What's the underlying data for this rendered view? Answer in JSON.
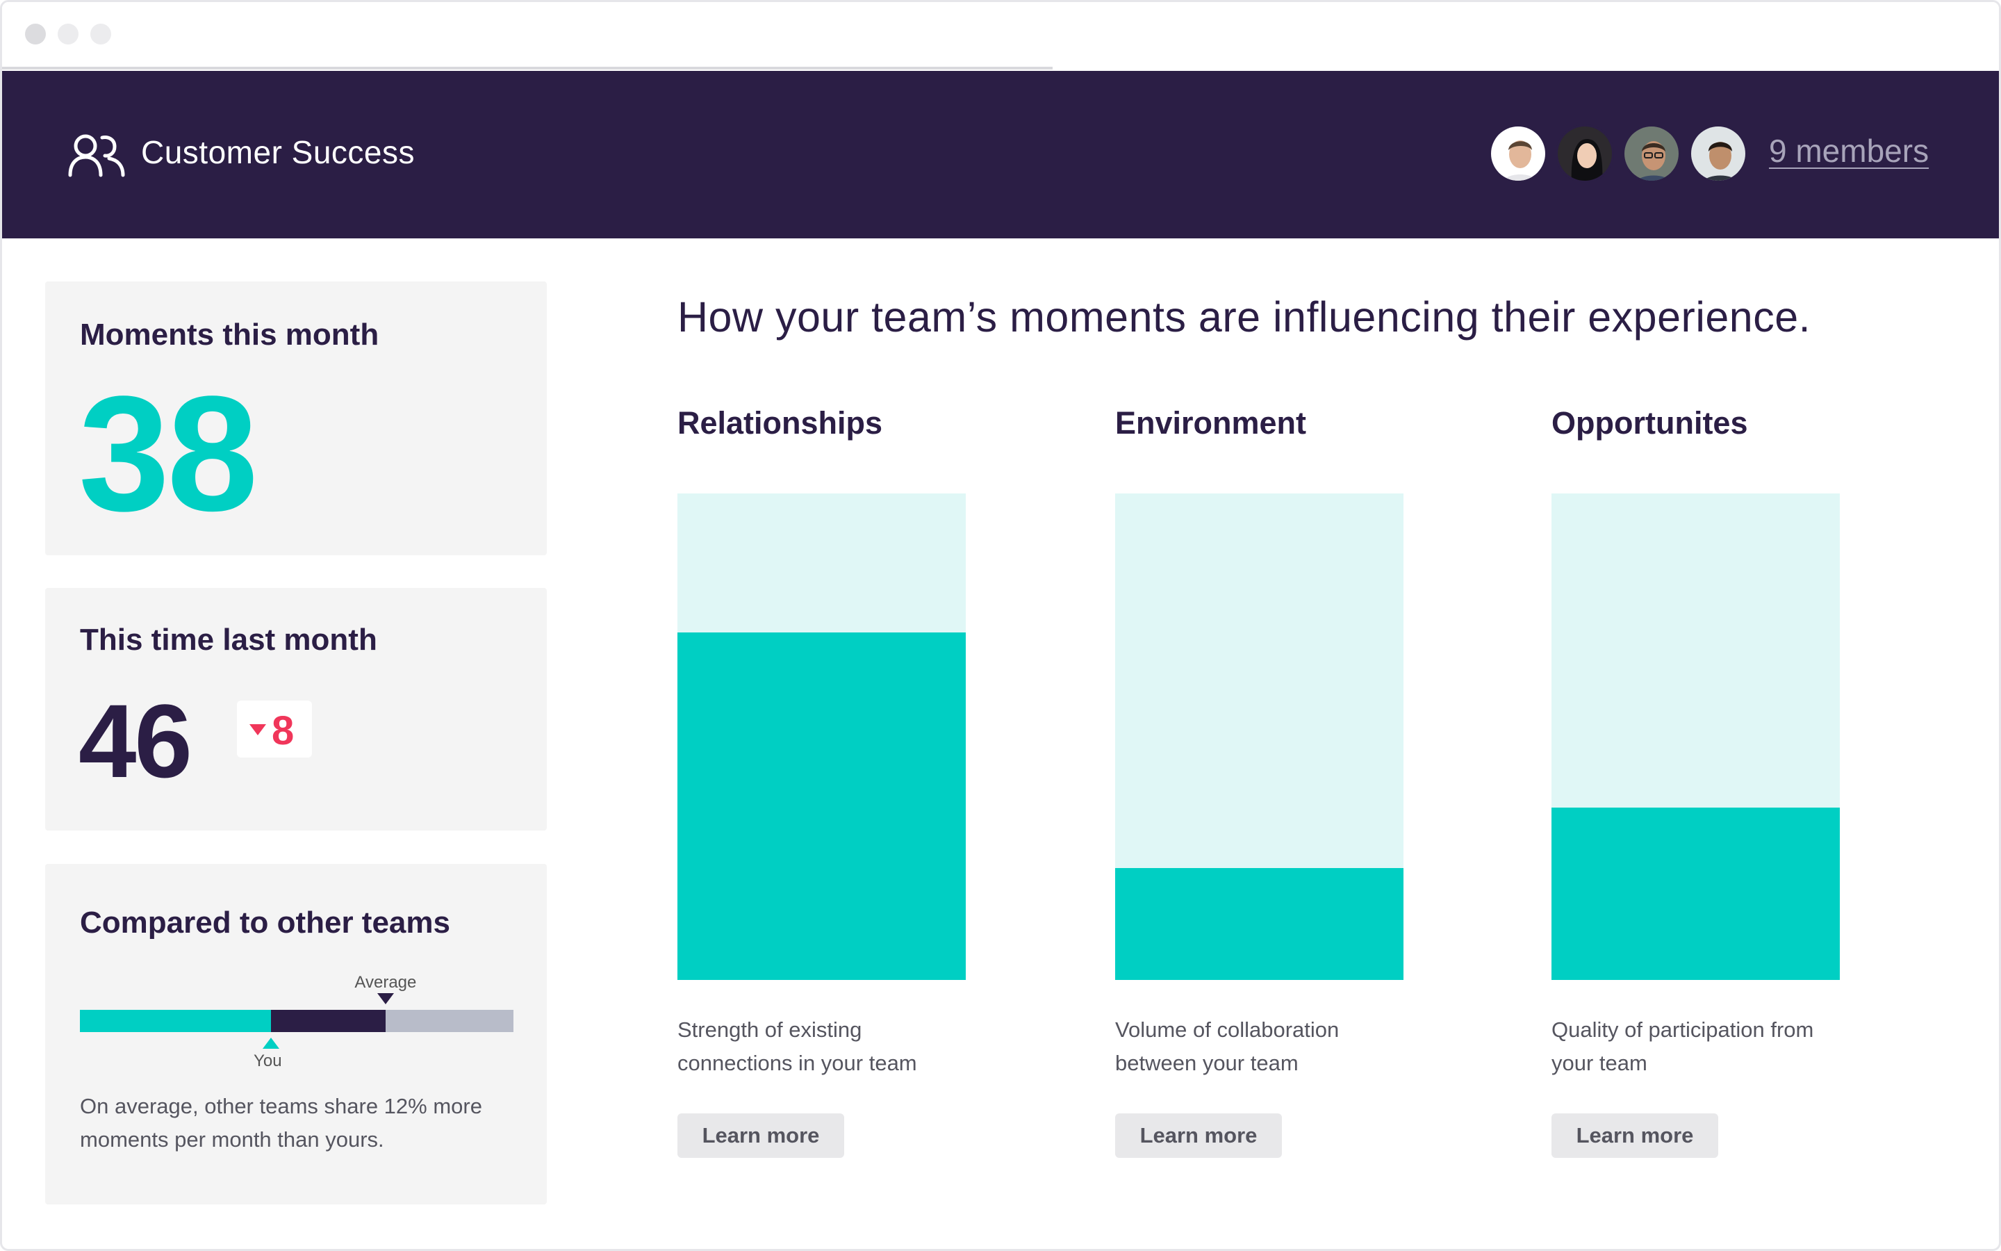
{
  "header": {
    "team_name": "Customer Success",
    "members_link": "9 members",
    "avatars": [
      {
        "name": "member-1",
        "skin": "#e2b79a",
        "hair": "#5a4534",
        "bg": "#ffffff"
      },
      {
        "name": "member-2",
        "skin": "#f0cdb5",
        "hair": "#0f0f12",
        "bg": "#2d2a2e"
      },
      {
        "name": "member-3",
        "skin": "#c69474",
        "hair": "#3a2c22",
        "bg": "#6f7a72"
      },
      {
        "name": "member-4",
        "skin": "#bf8f6c",
        "hair": "#241a14",
        "bg": "#dfe4e6"
      }
    ]
  },
  "cards": {
    "moments": {
      "title": "Moments this month",
      "value": "38"
    },
    "last_month": {
      "title": "This time last month",
      "value": "46",
      "delta": "8"
    },
    "compare": {
      "title": "Compared to other teams",
      "average_label": "Average",
      "you_label": "You",
      "you_fraction": 0.44,
      "average_fraction": 0.705,
      "description": "On average, other teams share 12% more moments per month than yours."
    }
  },
  "main": {
    "title": "How your team’s moments are influencing their experience.",
    "metrics": [
      {
        "title": "Relationships",
        "fill_fraction": 0.715,
        "description": "Strength of existing connections in your team",
        "button": "Learn more"
      },
      {
        "title": "Environment",
        "fill_fraction": 0.23,
        "description": "Volume of collaboration between your team",
        "button": "Learn more"
      },
      {
        "title": "Opportunites",
        "fill_fraction": 0.355,
        "description": "Quality of participation from your team",
        "button": "Learn more"
      }
    ]
  },
  "colors": {
    "header_bg": "#2b1e45",
    "accent": "#00cfc3",
    "accent_light": "#e0f7f6",
    "negative": "#f0365a",
    "card_bg": "#f4f4f4"
  }
}
